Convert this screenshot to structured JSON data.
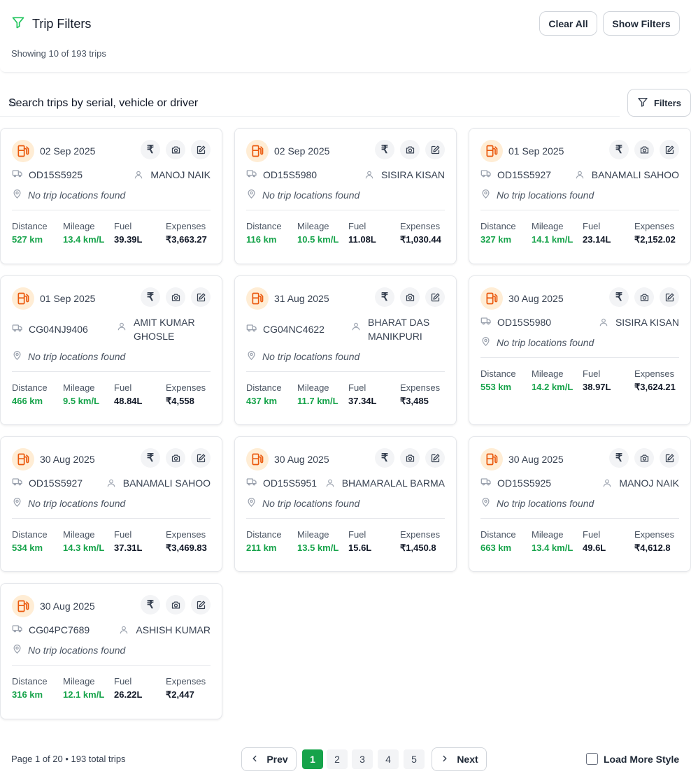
{
  "header": {
    "title": "Trip Filters",
    "subtitle": "Showing 10 of 193 trips",
    "clear_all_label": "Clear All",
    "show_filters_label": "Show Filters"
  },
  "search": {
    "placeholder": "Search trips by serial, vehicle or driver",
    "filters_label": "Filters"
  },
  "labels": {
    "no_locations": "No trip locations found",
    "distance": "Distance",
    "mileage": "Mileage",
    "fuel": "Fuel",
    "expenses": "Expenses",
    "rupee_symbol": "₹"
  },
  "trips": [
    {
      "date": "02 Sep 2025",
      "vehicle": "OD15S5925",
      "driver": "MANOJ NAIK",
      "distance": "527 km",
      "mileage": "13.4 km/L",
      "fuel": "39.39L",
      "expenses": "₹3,663.27"
    },
    {
      "date": "02 Sep 2025",
      "vehicle": "OD15S5980",
      "driver": "SISIRA KISAN",
      "distance": "116 km",
      "mileage": "10.5 km/L",
      "fuel": "11.08L",
      "expenses": "₹1,030.44"
    },
    {
      "date": "01 Sep 2025",
      "vehicle": "OD15S5927",
      "driver": "BANAMALI SAHOO",
      "distance": "327 km",
      "mileage": "14.1 km/L",
      "fuel": "23.14L",
      "expenses": "₹2,152.02"
    },
    {
      "date": "01 Sep 2025",
      "vehicle": "CG04NJ9406",
      "driver": "AMIT KUMAR GHOSLE",
      "distance": "466 km",
      "mileage": "9.5 km/L",
      "fuel": "48.84L",
      "expenses": "₹4,558"
    },
    {
      "date": "31 Aug 2025",
      "vehicle": "CG04NC4622",
      "driver": "BHARAT DAS MANIKPURI",
      "distance": "437 km",
      "mileage": "11.7 km/L",
      "fuel": "37.34L",
      "expenses": "₹3,485"
    },
    {
      "date": "30 Aug 2025",
      "vehicle": "OD15S5980",
      "driver": "SISIRA KISAN",
      "distance": "553 km",
      "mileage": "14.2 km/L",
      "fuel": "38.97L",
      "expenses": "₹3,624.21"
    },
    {
      "date": "30 Aug 2025",
      "vehicle": "OD15S5927",
      "driver": "BANAMALI SAHOO",
      "distance": "534 km",
      "mileage": "14.3 km/L",
      "fuel": "37.31L",
      "expenses": "₹3,469.83"
    },
    {
      "date": "30 Aug 2025",
      "vehicle": "OD15S5951",
      "driver": "BHAMARALAL BARMA",
      "distance": "211 km",
      "mileage": "13.5 km/L",
      "fuel": "15.6L",
      "expenses": "₹1,450.8"
    },
    {
      "date": "30 Aug 2025",
      "vehicle": "OD15S5925",
      "driver": "MANOJ NAIK",
      "distance": "663 km",
      "mileage": "13.4 km/L",
      "fuel": "49.6L",
      "expenses": "₹4,612.8"
    },
    {
      "date": "30 Aug 2025",
      "vehicle": "CG04PC7689",
      "driver": "ASHISH KUMAR",
      "distance": "316 km",
      "mileage": "12.1 km/L",
      "fuel": "26.22L",
      "expenses": "₹2,447"
    }
  ],
  "pagination": {
    "info": "Page 1 of 20 • 193 total trips",
    "prev_label": "Prev",
    "next_label": "Next",
    "pages": [
      "1",
      "2",
      "3",
      "4",
      "5"
    ],
    "current_page": "1",
    "load_more_label": "Load More Style"
  },
  "colors": {
    "accent_green": "#16a34a",
    "fuel_orange": "#ea580c",
    "fuel_badge_bg": "#ffedd5"
  },
  "icons": {
    "header": "filter-icon",
    "fuel": "fuel-pump-icon",
    "vehicle": "truck-icon",
    "driver": "user-icon",
    "location": "map-pin-icon",
    "actions": [
      "rupee-icon",
      "camera-icon",
      "edit-icon"
    ]
  }
}
